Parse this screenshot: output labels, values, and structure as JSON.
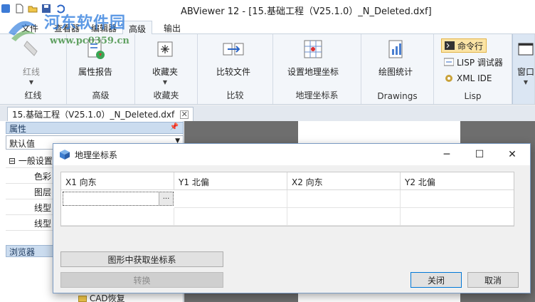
{
  "app": {
    "title": "ABViewer 12 - [15.基础工程（V25.1.0）_N_Deleted.dxf]"
  },
  "watermark": {
    "text": "河东软件园",
    "url": "www.pc0359.cn"
  },
  "ribbon_tabs": [
    {
      "label": "文件"
    },
    {
      "label": "查看器"
    },
    {
      "label": "编辑器"
    },
    {
      "label": "高级"
    },
    {
      "label": "输出"
    }
  ],
  "ribbon_groups": {
    "redline": {
      "button": "红线",
      "name": "红线"
    },
    "advanced": {
      "button": "属性报告",
      "name": "高级"
    },
    "favorites": {
      "button": "收藏夹",
      "name": "收藏夹"
    },
    "compare": {
      "button": "比较文件",
      "name": "比较"
    },
    "geo": {
      "button": "设置地理坐标",
      "name": "地理坐标系"
    },
    "drawings": {
      "button": "绘图统计",
      "name": "Drawings"
    },
    "lisp": {
      "cmd": "命令行",
      "debugger": "LISP 调试器",
      "ide": "XML IDE",
      "name": "Lisp"
    },
    "window": {
      "button": "窗口"
    }
  },
  "document_tab": {
    "label": "15.基础工程（V25.1.0）_N_Deleted.dxf"
  },
  "properties_panel": {
    "title": "属性",
    "combo_value": "默认值",
    "category": "一般设置",
    "rows": [
      "色彩",
      "图层",
      "线型",
      "线型"
    ],
    "browser_title": "浏览器",
    "tree_items": [
      "CAD恢复"
    ]
  },
  "dialog": {
    "title": "地理坐标系",
    "columns": [
      "X1 向东",
      "Y1 北偏",
      "X2 向东",
      "Y2 北偏"
    ],
    "ellipsis": "...",
    "get_from_drawing": "图形中获取坐标系",
    "convert": "转换",
    "close": "关闭",
    "cancel": "取消"
  },
  "colors": {
    "accent": "#2a6bd3",
    "panel_header": "#cbdcef",
    "highlight": "#fbe4a5"
  }
}
